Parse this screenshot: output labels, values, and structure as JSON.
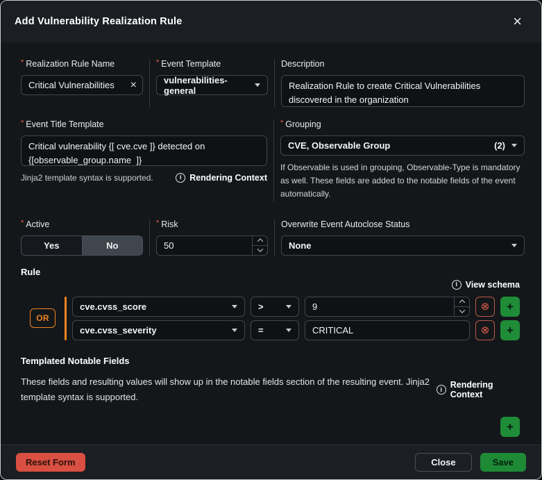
{
  "icons": {
    "close": "×",
    "clear": "×",
    "delete": "⊗",
    "add": "+",
    "info": "i",
    "required": "*"
  },
  "colors": {
    "accent_orange": "#ef8420",
    "danger_red": "#d94f41",
    "success_green": "#1f8c37",
    "required_marker": "#e0604c"
  },
  "modal": {
    "title": "Add Vulnerability Realization Rule"
  },
  "fields": {
    "rule_name": {
      "label": "Realization Rule Name",
      "value": "Critical Vulnerabilities"
    },
    "event_template": {
      "label": "Event Template",
      "value": "vulnerabilities-general"
    },
    "description": {
      "label": "Description",
      "value": "Realization Rule to create Critical Vulnerabilities discovered in the organization"
    },
    "event_title_template": {
      "label": "Event Title Template",
      "value": "Critical vulnerability {[ cve.cve ]} detected on\n{[observable_group.name  ]}",
      "hint": "Jinja2 template syntax is supported.",
      "context_link": "Rendering Context"
    },
    "grouping": {
      "label": "Grouping",
      "value": "CVE, Observable Group",
      "count": "(2)",
      "hint": "If Observable is used in grouping, Observable-Type is mandatory as well. These fields are added to the notable fields of the event automatically."
    },
    "active": {
      "label": "Active",
      "yes": "Yes",
      "no": "No",
      "selected": "No"
    },
    "risk": {
      "label": "Risk",
      "value": "50"
    },
    "autoclose": {
      "label": "Overwrite Event Autoclose Status",
      "value": "None"
    }
  },
  "rule": {
    "heading": "Rule",
    "schema_link": "View schema",
    "operator_badge": "OR",
    "conditions": [
      {
        "field": "cve.cvss_score",
        "operator": ">",
        "value": "9"
      },
      {
        "field": "cve.cvss_severity",
        "operator": "=",
        "value": "CRITICAL"
      }
    ]
  },
  "notable": {
    "heading": "Templated Notable Fields",
    "description": "These fields and resulting values will show up in the notable fields section of the resulting event. Jinja2 template syntax is supported.",
    "context_link": "Rendering Context"
  },
  "footer": {
    "reset_label": "Reset Form",
    "close_label": "Close",
    "save_label": "Save"
  }
}
